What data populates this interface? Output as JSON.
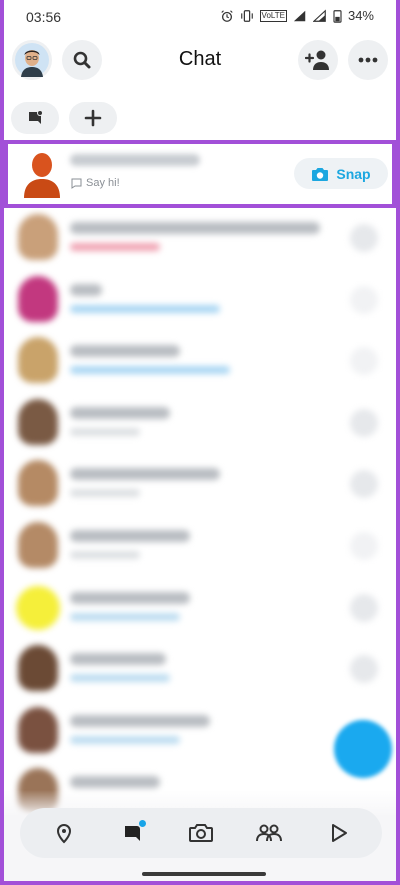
{
  "status_bar": {
    "time": "03:56",
    "battery": "34%",
    "network_label": "VoLTE"
  },
  "header": {
    "title": "Chat"
  },
  "highlighted_chat": {
    "say_hi": "Say hi!",
    "snap_label": "Snap"
  },
  "nav": {
    "items": [
      "map",
      "chat",
      "camera",
      "friends",
      "stories"
    ],
    "active": "chat"
  },
  "colors": {
    "highlight_border": "#a250d8",
    "accent": "#1ca7e0",
    "background": "#ffffff"
  }
}
